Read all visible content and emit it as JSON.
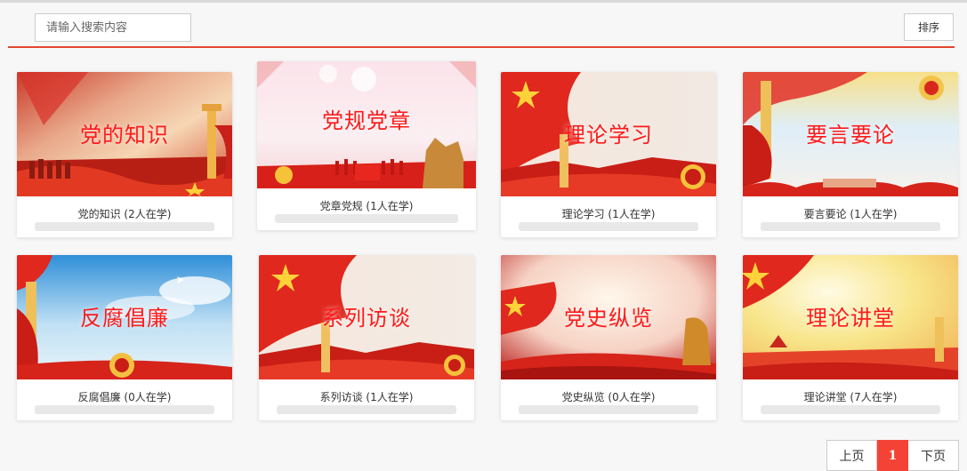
{
  "search": {
    "placeholder": "请输入搜索内容"
  },
  "toolbar": {
    "sort_label": "排序"
  },
  "colors": {
    "accent": "#e2462e",
    "title_red": "#ff1a1a",
    "page_active": "#f44336"
  },
  "courses": [
    {
      "image_title": "党的知识",
      "caption": "党的知识 (2人在学)"
    },
    {
      "image_title": "党规党章",
      "caption": "党章党规 (1人在学)"
    },
    {
      "image_title": "理论学习",
      "caption": "理论学习 (1人在学)"
    },
    {
      "image_title": "要言要论",
      "caption": "要言要论 (1人在学)"
    },
    {
      "image_title": "反腐倡廉",
      "caption": "反腐倡廉 (0人在学)"
    },
    {
      "image_title": "系列访谈",
      "caption": "系列访谈 (1人在学)"
    },
    {
      "image_title": "党史纵览",
      "caption": "党史纵览 (0人在学)"
    },
    {
      "image_title": "理论讲堂",
      "caption": "理论讲堂 (7人在学)"
    }
  ],
  "pagination": {
    "prev_label": "上页",
    "current": "1",
    "next_label": "下页"
  }
}
